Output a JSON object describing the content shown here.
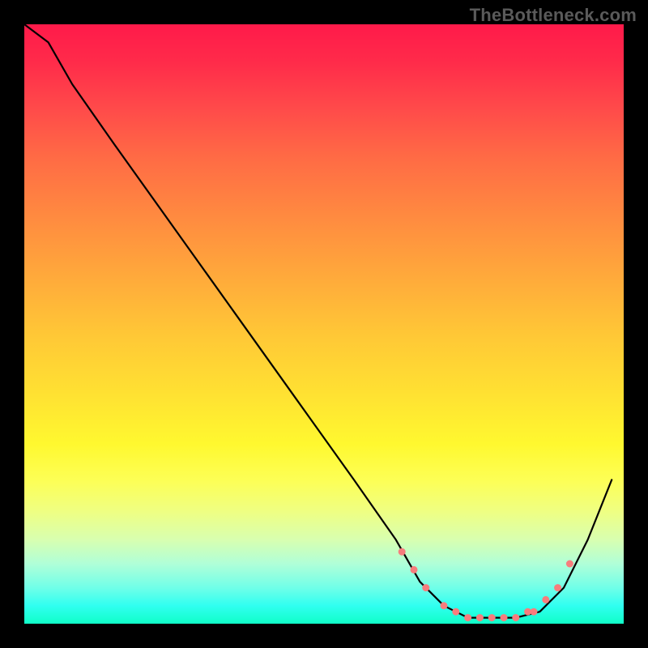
{
  "attribution": "TheBottleneck.com",
  "chart_data": {
    "type": "line",
    "title": "",
    "xlabel": "",
    "ylabel": "",
    "xlim": [
      0,
      100
    ],
    "ylim": [
      0,
      100
    ],
    "grid": false,
    "legend": false,
    "description": "Single black curve over a vertical rainbow gradient (red top → green bottom). Curve descends from top-left, reaches a flat trough near bottom-right around x≈70–85, then rises again. Coral dot markers highlight the trough region.",
    "series": [
      {
        "name": "bottleneck-curve",
        "x": [
          0,
          4,
          8,
          15,
          25,
          35,
          45,
          55,
          62,
          66,
          70,
          74,
          78,
          82,
          86,
          90,
          94,
          98
        ],
        "values": [
          100,
          97,
          90,
          80,
          66,
          52,
          38,
          24,
          14,
          7,
          3,
          1,
          1,
          1,
          2,
          6,
          14,
          24
        ]
      }
    ],
    "markers": {
      "name": "trough-dots",
      "color": "#f77d7d",
      "x": [
        63,
        65,
        67,
        70,
        72,
        74,
        76,
        78,
        80,
        82,
        84,
        85,
        87,
        89,
        91
      ],
      "values": [
        12,
        9,
        6,
        3,
        2,
        1,
        1,
        1,
        1,
        1,
        2,
        2,
        4,
        6,
        10
      ]
    }
  }
}
